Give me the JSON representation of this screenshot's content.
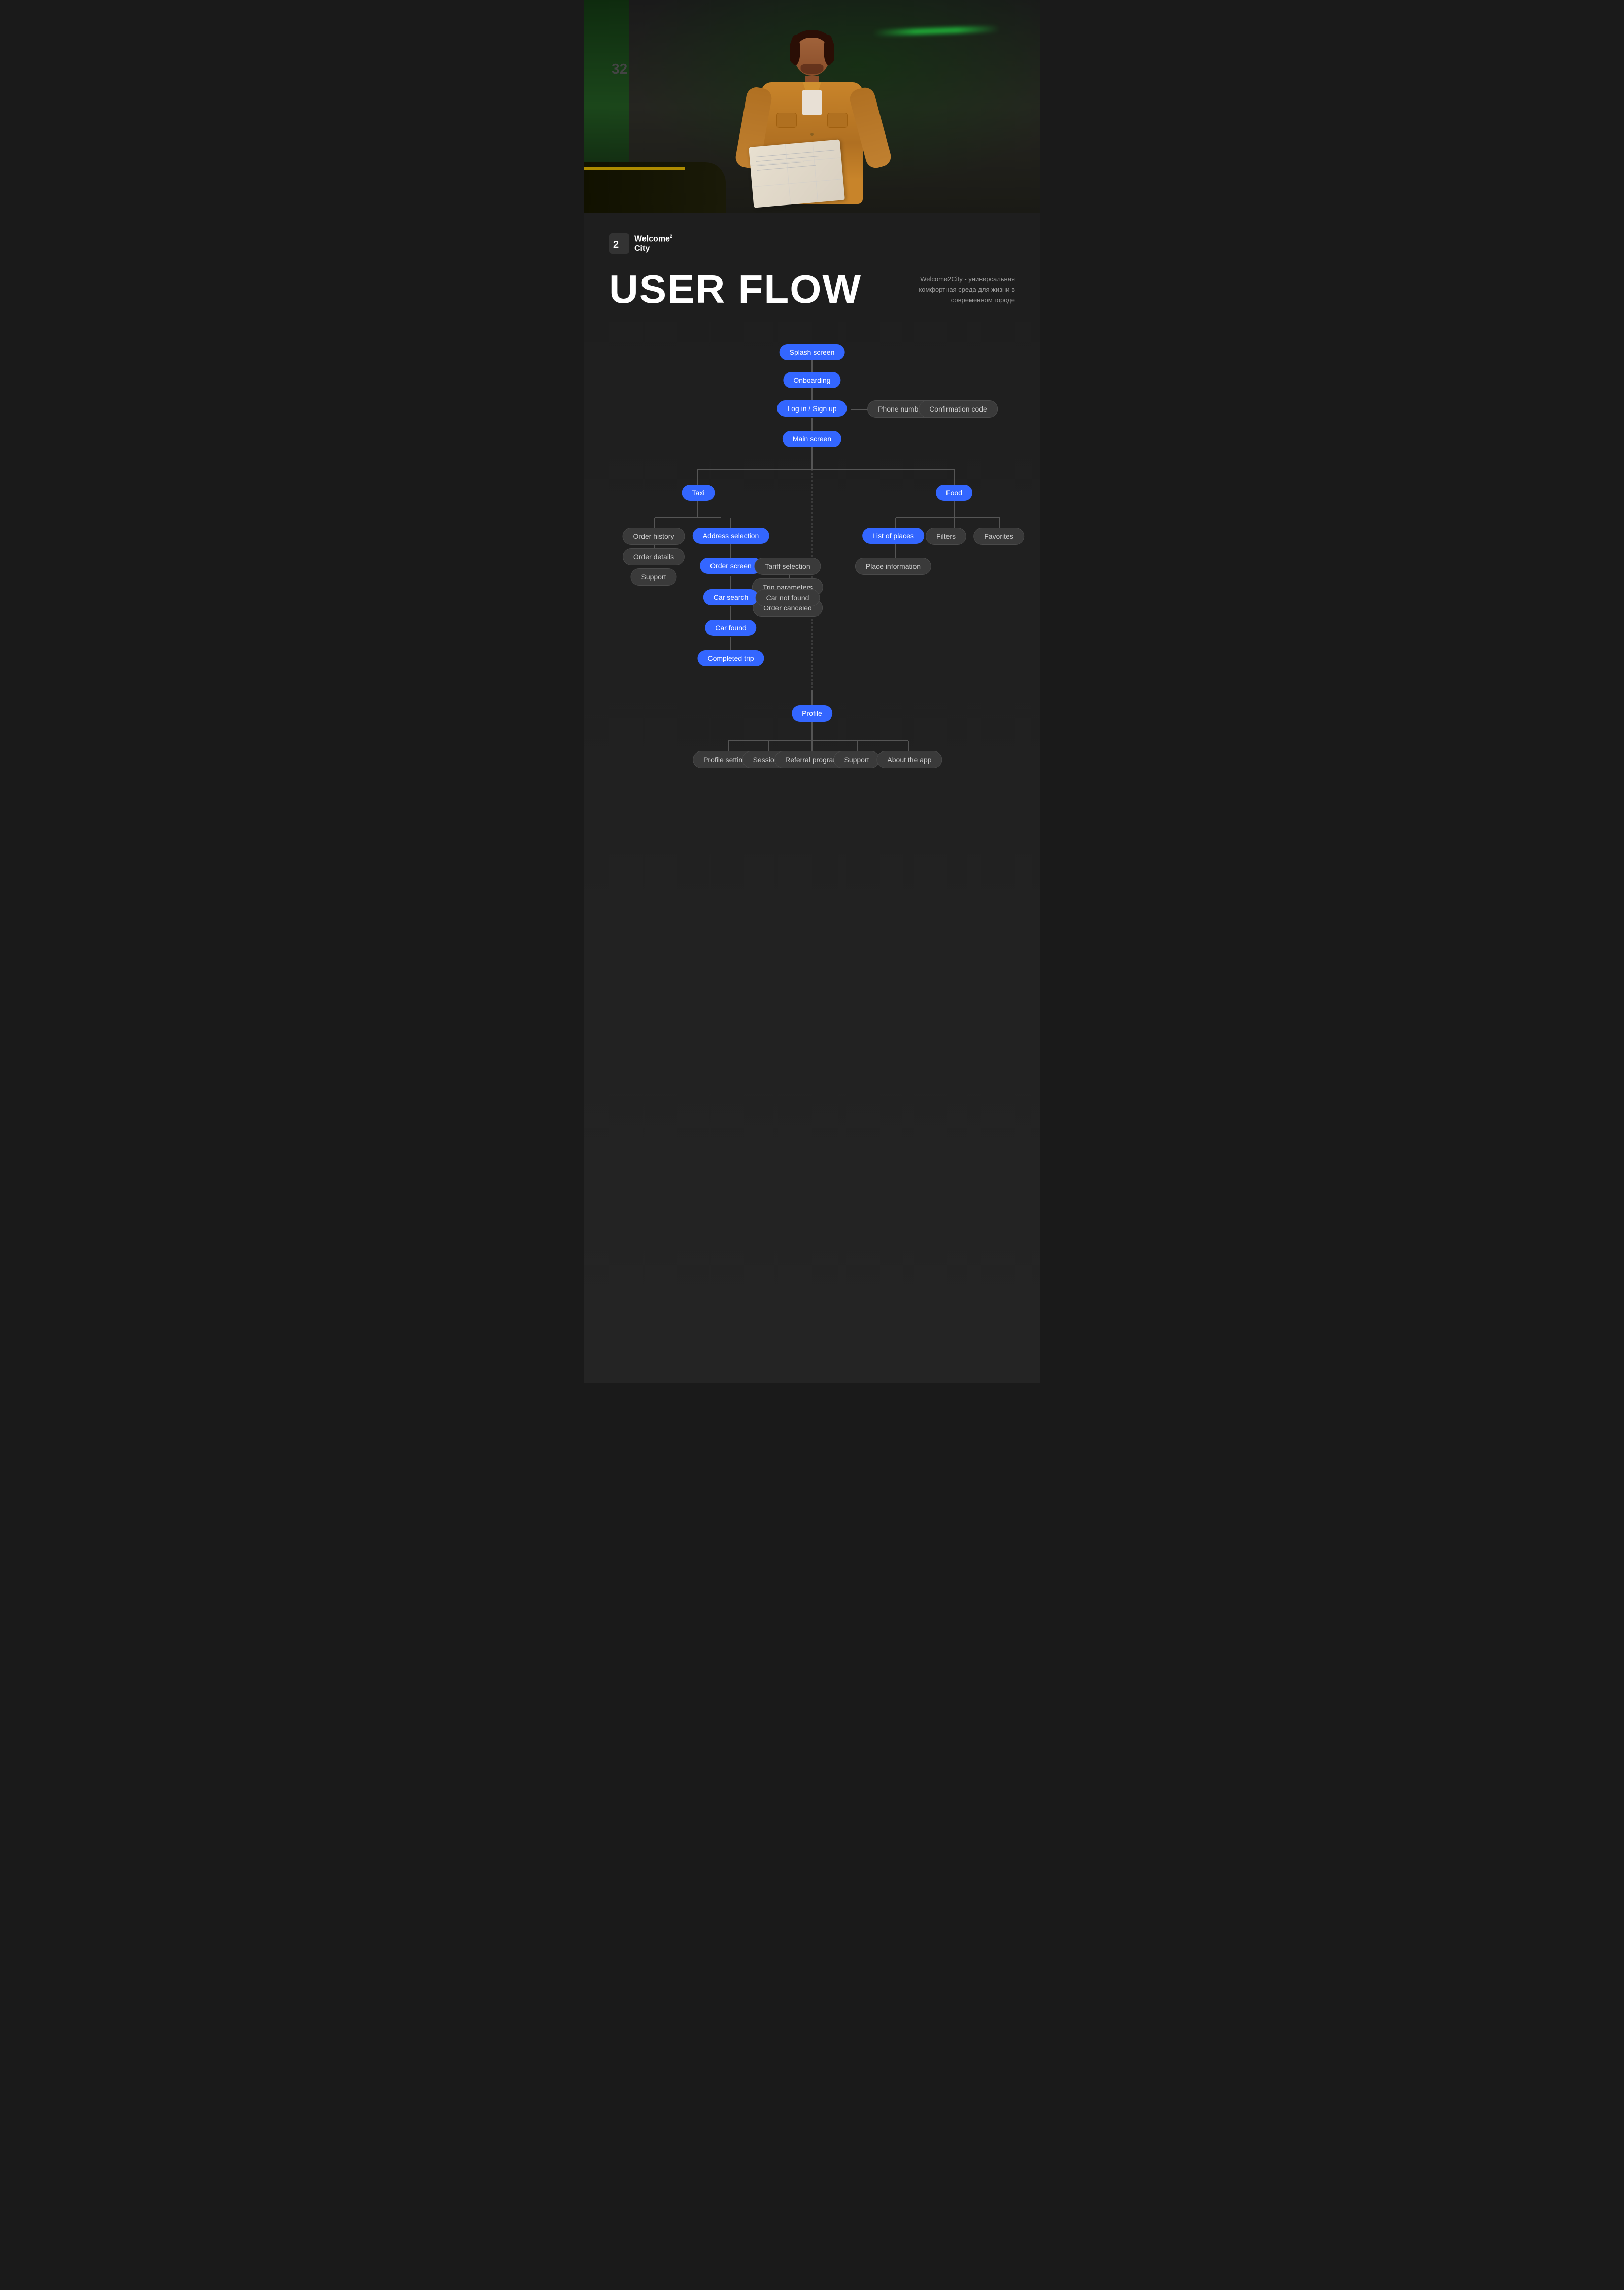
{
  "hero": {
    "alt": "Person reading a map next to a car"
  },
  "logo": {
    "icon": "2",
    "line1": "Welcome",
    "sup": "2",
    "line2": "City"
  },
  "header": {
    "title": "USER FLOW",
    "subtitle": "Welcome2City - универсальная комфортная среда для жизни в современном городе"
  },
  "flow": {
    "nodes": {
      "splash": "Splash screen",
      "onboarding": "Onboarding",
      "login": "Log in / Sign up",
      "phone": "Phone number",
      "confirmation": "Confirmation code",
      "main": "Main screen",
      "taxi": "Taxi",
      "food": "Food",
      "order_history": "Order history",
      "order_details": "Order details",
      "support_taxi": "Support",
      "address_selection": "Address selection",
      "order_screen": "Order screen",
      "tariff_selection": "Tariff selection",
      "trip_parameters": "Trip parameters",
      "order_canceled": "Order canceled",
      "car_search": "Car search",
      "car_not_found": "Car not found",
      "car_found": "Car found",
      "completed_trip": "Completed trip",
      "list_of_places": "List of places",
      "filters": "Filters",
      "favorites": "Favorites",
      "place_information": "Place information",
      "profile": "Profile",
      "profile_settings": "Profile settings",
      "sessions": "Sessions",
      "referral_program": "Referral program",
      "support_profile": "Support",
      "about_app": "About the app"
    },
    "colors": {
      "blue": "#3366ff",
      "dark": "#3a3a3a",
      "line": "#555555"
    }
  }
}
